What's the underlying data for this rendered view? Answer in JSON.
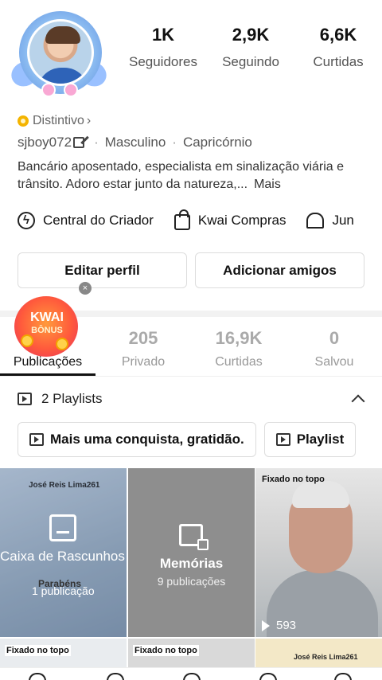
{
  "profile": {
    "stats": [
      {
        "value": "1K",
        "label": "Seguidores"
      },
      {
        "value": "2,9K",
        "label": "Seguindo"
      },
      {
        "value": "6,6K",
        "label": "Curtidas"
      }
    ],
    "badge": "Distintivo",
    "badge_chevron": "›",
    "username": "sjboy072",
    "gender": "Masculino",
    "zodiac": "Capricórnio",
    "separator": "·",
    "bio": "Bancário aposentado, especialista em sinalização viária e trânsito. Adoro estar junto da natureza,...",
    "bio_more": "Mais"
  },
  "links": [
    {
      "label": "Central do Criador",
      "icon": "bolt-icon"
    },
    {
      "label": "Kwai Compras",
      "icon": "shopping-bag-icon"
    },
    {
      "label": "Jun",
      "icon": "home-icon"
    }
  ],
  "buttons": {
    "edit": "Editar perfil",
    "add": "Adicionar amigos"
  },
  "promo": {
    "title": "KWAI",
    "subtitle": "BÔNUS",
    "close": "×"
  },
  "tabs": [
    {
      "count": "",
      "label": "Publicações",
      "active": true
    },
    {
      "count": "205",
      "label": "Privado"
    },
    {
      "count": "16,9K",
      "label": "Curtidas"
    },
    {
      "count": "0",
      "label": "Salvou"
    }
  ],
  "playlists": {
    "header": "2 Playlists",
    "items": [
      "Mais uma conquista, gratidão.",
      "Playlist"
    ]
  },
  "grid": {
    "drafts": {
      "title": "Caixa de Rascunhos",
      "count": "1 publicação",
      "user": "José Reis Lima261",
      "overlay_text": "Parabéns"
    },
    "memories": {
      "title": "Memórias",
      "count": "9 publicações"
    },
    "pinned_video": {
      "pin": "Fixado no topo",
      "views": "593"
    }
  },
  "row2": {
    "pin": "Fixado no topo",
    "user": "José Reis Lima261"
  }
}
